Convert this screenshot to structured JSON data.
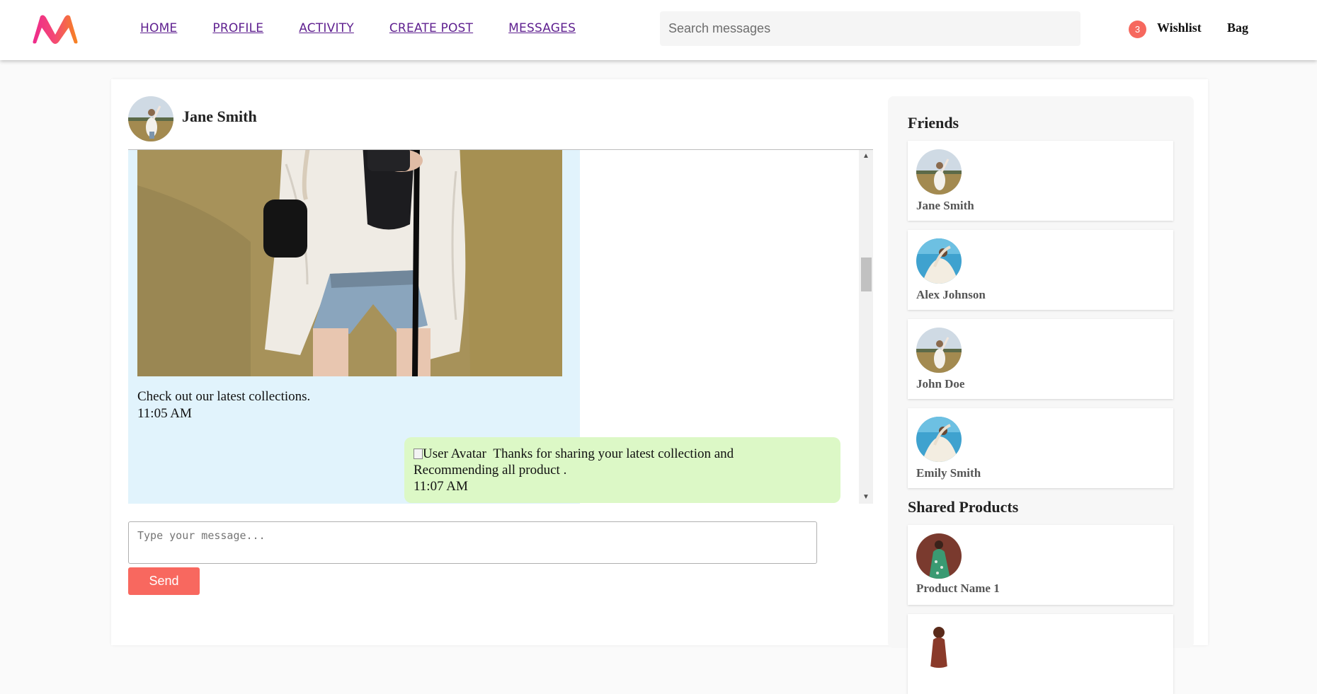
{
  "nav": {
    "home": "HOME",
    "profile": "PROFILE",
    "activity": "ACTIVITY",
    "create_post": "CREATE POST",
    "messages": "MESSAGES"
  },
  "search": {
    "placeholder": "Search messages"
  },
  "header": {
    "badge_count": "3",
    "wishlist": "Wishlist",
    "bag": "Bag"
  },
  "chat": {
    "contact_name": "Jane Smith",
    "incoming": {
      "text": "Check out our latest collections.",
      "time": "11:05 AM"
    },
    "outgoing": {
      "avatar_alt": "User Avatar",
      "text_line1": "Thanks for sharing your latest collection and",
      "text_line2": "Recommending all product .",
      "time": "11:07 AM"
    },
    "input_placeholder": "Type your message...",
    "send_label": "Send"
  },
  "friends": {
    "heading": "Friends",
    "items": [
      {
        "name": "Jane Smith"
      },
      {
        "name": "Alex Johnson"
      },
      {
        "name": "John Doe"
      },
      {
        "name": "Emily Smith"
      }
    ]
  },
  "shared_products": {
    "heading": "Shared Products",
    "items": [
      {
        "name": "Product Name 1"
      }
    ]
  },
  "colors": {
    "accent": "#f8685f",
    "nav_link": "#5e1f8f",
    "incoming_bubble": "#e1f3fc",
    "outgoing_bubble": "#dcf8c6"
  }
}
